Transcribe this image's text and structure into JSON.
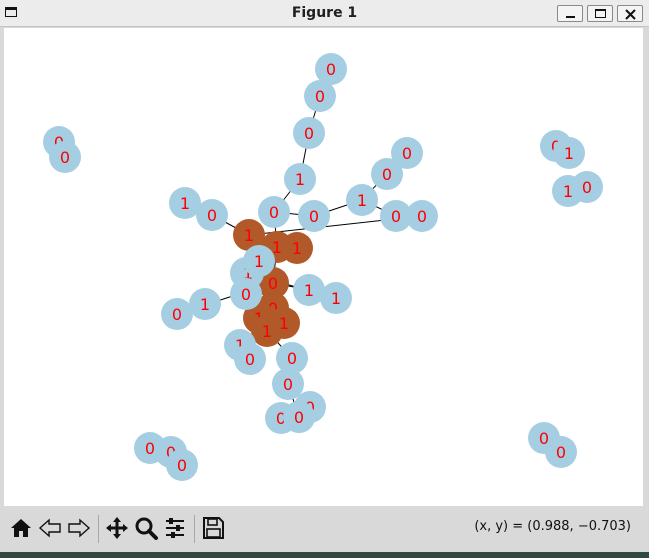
{
  "window": {
    "title": "Figure 1"
  },
  "toolbar": {
    "buttons": [
      {
        "name": "home-icon"
      },
      {
        "name": "back-icon"
      },
      {
        "name": "forward-icon"
      },
      {
        "name": "pan-icon"
      },
      {
        "name": "zoom-icon"
      },
      {
        "name": "configure-subplots-icon"
      },
      {
        "name": "save-icon"
      }
    ],
    "coordinates": "(x, y) = (0.988, −0.703)"
  },
  "graph": {
    "colors": {
      "node_light": "#a6cee3",
      "node_dark": "#b15928",
      "label": "#ff0000",
      "edge": "#000000"
    },
    "nodes": [
      {
        "id": "a0",
        "label": "0",
        "color": "light"
      },
      {
        "id": "a1",
        "label": "0",
        "color": "light"
      },
      {
        "id": "a2",
        "label": "0",
        "color": "light"
      },
      {
        "id": "a3",
        "label": "1",
        "color": "light"
      },
      {
        "id": "b1",
        "label": "1",
        "color": "light"
      },
      {
        "id": "b2",
        "label": "0",
        "color": "light"
      },
      {
        "id": "c0",
        "label": "0",
        "color": "light"
      },
      {
        "id": "c1",
        "label": "0",
        "color": "light"
      },
      {
        "id": "c2",
        "label": "1",
        "color": "light"
      },
      {
        "id": "c3",
        "label": "0",
        "color": "light"
      },
      {
        "id": "c4",
        "label": "0",
        "color": "light"
      },
      {
        "id": "d0",
        "label": "0",
        "color": "light"
      },
      {
        "id": "d1",
        "label": "0",
        "color": "light"
      },
      {
        "id": "h1",
        "label": "1",
        "color": "dark"
      },
      {
        "id": "h2",
        "label": "1",
        "color": "dark"
      },
      {
        "id": "h3",
        "label": "1",
        "color": "dark"
      },
      {
        "id": "h4",
        "label": "0",
        "color": "dark"
      },
      {
        "id": "h5",
        "label": "0",
        "color": "dark"
      },
      {
        "id": "h6",
        "label": "1",
        "color": "dark"
      },
      {
        "id": "h7",
        "label": "1",
        "color": "dark"
      },
      {
        "id": "h8",
        "label": "1",
        "color": "dark"
      },
      {
        "id": "e1",
        "label": "1",
        "color": "light"
      },
      {
        "id": "e2",
        "label": "1",
        "color": "light"
      },
      {
        "id": "e3",
        "label": "0",
        "color": "light"
      },
      {
        "id": "f1",
        "label": "1",
        "color": "light"
      },
      {
        "id": "f2",
        "label": "1",
        "color": "light"
      },
      {
        "id": "g1",
        "label": "0",
        "color": "light"
      },
      {
        "id": "g2",
        "label": "1",
        "color": "light"
      },
      {
        "id": "i1",
        "label": "1",
        "color": "light"
      },
      {
        "id": "i2",
        "label": "0",
        "color": "light"
      },
      {
        "id": "j1",
        "label": "0",
        "color": "light"
      },
      {
        "id": "j2",
        "label": "0",
        "color": "light"
      },
      {
        "id": "j3",
        "label": "0",
        "color": "light"
      },
      {
        "id": "j4",
        "label": "0",
        "color": "light"
      },
      {
        "id": "j5",
        "label": "0",
        "color": "light"
      },
      {
        "id": "k1",
        "label": "0",
        "color": "light"
      },
      {
        "id": "k2",
        "label": "0",
        "color": "light"
      },
      {
        "id": "l1",
        "label": "0",
        "color": "light"
      },
      {
        "id": "l2",
        "label": "1",
        "color": "light"
      },
      {
        "id": "l3",
        "label": "1",
        "color": "light"
      },
      {
        "id": "l4",
        "label": "0",
        "color": "light"
      },
      {
        "id": "m1",
        "label": "0",
        "color": "light"
      },
      {
        "id": "m2",
        "label": "0",
        "color": "light"
      },
      {
        "id": "m3",
        "label": "0",
        "color": "light"
      },
      {
        "id": "n1",
        "label": "0",
        "color": "light"
      },
      {
        "id": "n2",
        "label": "0",
        "color": "light"
      }
    ],
    "edges": [
      [
        "a0",
        "a1"
      ],
      [
        "a1",
        "a2"
      ],
      [
        "a2",
        "a3"
      ],
      [
        "a3",
        "d1"
      ],
      [
        "d0",
        "h1"
      ],
      [
        "d1",
        "h2"
      ],
      [
        "d1",
        "c0"
      ],
      [
        "c0",
        "c2"
      ],
      [
        "c2",
        "c1"
      ],
      [
        "c1",
        "c3"
      ],
      [
        "c2",
        "c4"
      ],
      [
        "b1",
        "b2"
      ],
      [
        "b2",
        "h1"
      ],
      [
        "h1",
        "h2"
      ],
      [
        "h2",
        "h3"
      ],
      [
        "h1",
        "h4"
      ],
      [
        "h2",
        "h4"
      ],
      [
        "h4",
        "e1"
      ],
      [
        "h4",
        "h5"
      ],
      [
        "h5",
        "h6"
      ],
      [
        "h6",
        "h7"
      ],
      [
        "h7",
        "h8"
      ],
      [
        "h5",
        "h8"
      ],
      [
        "e1",
        "e2"
      ],
      [
        "e2",
        "e3"
      ],
      [
        "e3",
        "f1"
      ],
      [
        "f1",
        "f2"
      ],
      [
        "h4",
        "g1"
      ],
      [
        "h4",
        "i2"
      ],
      [
        "i2",
        "i1"
      ],
      [
        "h7",
        "g2"
      ],
      [
        "g2",
        "j1"
      ],
      [
        "h7",
        "j2"
      ],
      [
        "j2",
        "j3"
      ],
      [
        "j3",
        "j5"
      ],
      [
        "j3",
        "j4"
      ]
    ]
  }
}
